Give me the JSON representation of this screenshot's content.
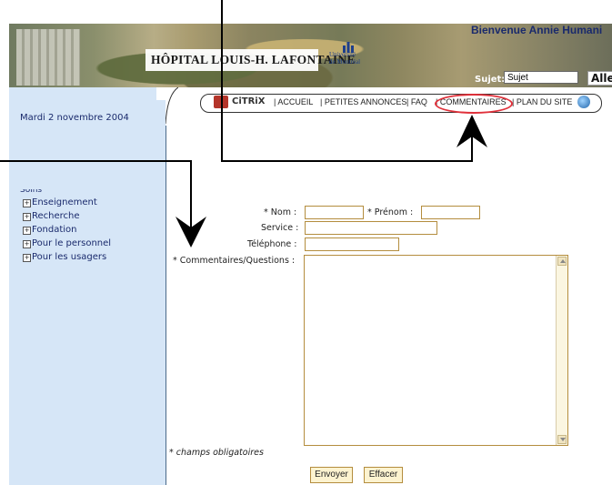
{
  "header": {
    "hospital_title": "HÔPITAL LOUIS-H. LAFONTAINE",
    "udem_line1": "Université",
    "udem_line2": "de Montréal",
    "welcome": "Bienvenue Annie Humani",
    "sujet_label": "Sujet:",
    "sujet_value": "Sujet",
    "go_button": "Allez!"
  },
  "sidebar": {
    "date": "Mardi 2 novembre 2004",
    "cut_item": "Soins",
    "items": [
      {
        "icon": "plus-box-icon",
        "label": "Enseignement"
      },
      {
        "icon": "plus-box-icon",
        "label": "Recherche"
      },
      {
        "icon": "plus-box-icon",
        "label": "Fondation"
      },
      {
        "icon": "plus-box-icon",
        "label": "Pour le personnel"
      },
      {
        "icon": "plus-box-icon",
        "label": "Pour les usagers"
      }
    ]
  },
  "nav": {
    "citrix": "CiTRiX",
    "items": [
      "| ACCUEIL",
      "| PETITES ANNONCES",
      "| FAQ",
      "| COMMENTAIRES",
      "| PLAN DU SITE"
    ],
    "highlighted": "COMMENTAIRES",
    "highlight_color": "#e0303a"
  },
  "form": {
    "nom_label": "* Nom :",
    "prenom_label": "* Prénom :",
    "service_label": "Service :",
    "telephone_label": "Téléphone :",
    "comments_label": "* Commentaires/Questions :",
    "required_note": "* champs obligatoires",
    "submit_button": "Envoyer",
    "reset_button": "Effacer"
  },
  "colors": {
    "sidebar_bg": "#d6e6f7",
    "field_border": "#b48d3e",
    "button_bg": "#fdf3d0",
    "link_text": "#1a2a6c"
  }
}
